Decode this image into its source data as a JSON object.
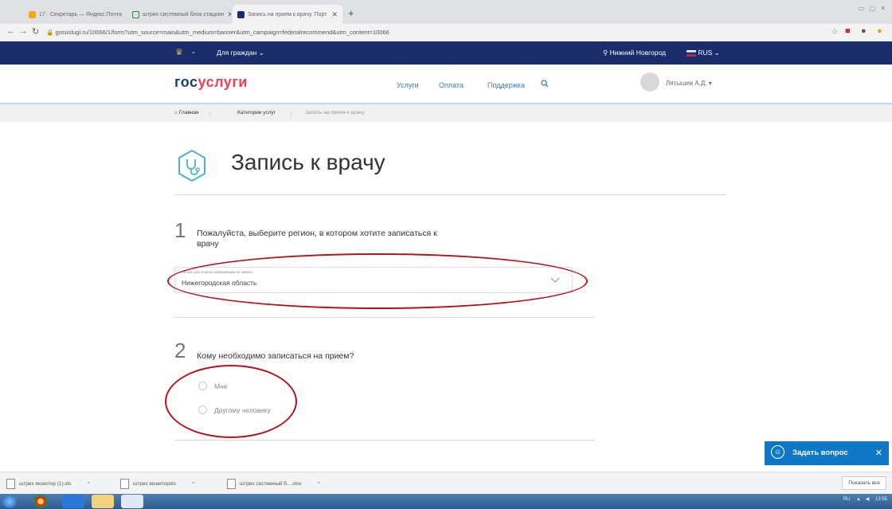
{
  "browser": {
    "tabs": [
      {
        "title": "17 · Секретарь — Яндекс.Почта",
        "active": false
      },
      {
        "title": "штрих системный блок стацион",
        "active": false
      },
      {
        "title": "Запись на прием к врачу. Порт",
        "active": true
      }
    ],
    "new_tab": "+",
    "url": "gosuslugi.ru/10066/1/form?utm_source=main&utm_medium=banner&utm_campaign=federalrecommend&utm_content=10066"
  },
  "topbar": {
    "audience": "Для граждан",
    "city": "Нижний Новгород",
    "language": "RUS"
  },
  "header": {
    "logo_part1": "гос",
    "logo_part2": "услуги",
    "menu": [
      "Услуги",
      "Оплата",
      "Поддержка"
    ],
    "user_name": "Лятышев А.Д."
  },
  "breadcrumbs": [
    "Главная",
    "Категории услуг",
    "Запись на прием к врачу"
  ],
  "page": {
    "title": "Запись к врачу",
    "step1": {
      "number": "1",
      "question_line1": "Пожалуйста, выберите регион, в котором хотите записаться к",
      "question_line2": "врачу",
      "select_label": "Регион для поиска информации по записи",
      "select_value": "Нижегородская область"
    },
    "step2": {
      "number": "2",
      "question": "Кому необходимо записаться на прием?",
      "options": [
        "Мне",
        "Другому человеку"
      ]
    }
  },
  "chat": {
    "label": "Задать вопрос",
    "close": "✕"
  },
  "downloads": {
    "items": [
      "штрих монитор (1).xls",
      "штрих мониторxls",
      "штрих системный б....xlsx"
    ],
    "show_all": "Показать все"
  },
  "taskbar": {
    "lang": "RU",
    "time": "13:55"
  },
  "colors": {
    "brand_blue": "#1b2c6b",
    "logo_red": "#ee3f58",
    "link_blue": "#3d7cb3",
    "chat_blue": "#0f78c6",
    "annotation_red": "#b5131b"
  }
}
